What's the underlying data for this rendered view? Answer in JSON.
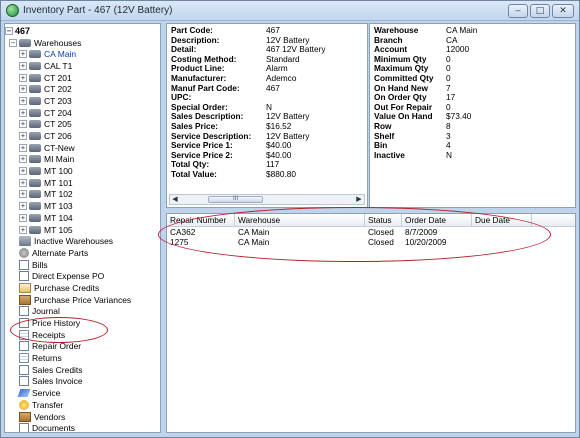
{
  "window": {
    "title": "Inventory Part - 467 (12V Battery)",
    "buttons": [
      "‒",
      "□",
      "✕"
    ]
  },
  "tree": {
    "root": "467",
    "warehouses_label": "Warehouses",
    "warehouses": [
      "CA Main",
      "CAL T1",
      "CT 201",
      "CT 202",
      "CT 203",
      "CT 204",
      "CT 205",
      "CT 206",
      "CT-New",
      "MI Main",
      "MT 100",
      "MT 101",
      "MT 102",
      "MT 103",
      "MT 104",
      "MT 105"
    ],
    "other_items": [
      "Inactive Warehouses",
      "Alternate Parts",
      "Bills",
      "Direct Expense PO",
      "Purchase Credits",
      "Purchase Price Variances",
      "Journal",
      "Price History",
      "Receipts",
      "Repair Order",
      "Returns",
      "Sales Credits",
      "Sales Invoice",
      "Service",
      "Transfer",
      "Vendors",
      "Documents"
    ]
  },
  "part_details": {
    "rows": [
      {
        "key": "Part Code:",
        "value": "467"
      },
      {
        "key": "Description:",
        "value": "12V Battery"
      },
      {
        "key": "Detail:",
        "value": "467 12V Battery"
      },
      {
        "key": "Costing Method:",
        "value": "Standard"
      },
      {
        "key": "Product Line:",
        "value": "Alarm"
      },
      {
        "key": "Manufacturer:",
        "value": "Ademco"
      },
      {
        "key": "Manuf Part Code:",
        "value": "467"
      },
      {
        "key": "UPC:",
        "value": ""
      },
      {
        "key": "Special Order:",
        "value": "N"
      },
      {
        "key": "Sales Description:",
        "value": "12V Battery"
      },
      {
        "key": "Sales Price:",
        "value": "$16.52"
      },
      {
        "key": "Service Description:",
        "value": "12V Battery"
      },
      {
        "key": "Service Price 1:",
        "value": "$40.00"
      },
      {
        "key": "Service Price 2:",
        "value": "$40.00"
      },
      {
        "key": "Total Qty:",
        "value": "117"
      },
      {
        "key": "Total Value:",
        "value": "$880.80"
      }
    ],
    "scroll_thumb": "III"
  },
  "warehouse_details": {
    "rows": [
      {
        "key": "Warehouse",
        "value": "CA Main"
      },
      {
        "key": "Branch",
        "value": "CA"
      },
      {
        "key": "Account",
        "value": "12000"
      },
      {
        "key": "Minimum Qty",
        "value": "0"
      },
      {
        "key": "Maximum Qty",
        "value": "0"
      },
      {
        "key": "Committed Qty",
        "value": "0"
      },
      {
        "key": "On Hand New",
        "value": "7"
      },
      {
        "key": "On Order Qty",
        "value": "17"
      },
      {
        "key": "Out For Repair",
        "value": "0"
      },
      {
        "key": "Value On Hand",
        "value": "$73.40"
      },
      {
        "key": "Row",
        "value": "8"
      },
      {
        "key": "Shelf",
        "value": "3"
      },
      {
        "key": "Bin",
        "value": "4"
      },
      {
        "key": "Inactive",
        "value": "N"
      }
    ]
  },
  "repair_table": {
    "columns": [
      "Repair Number",
      "Warehouse",
      "Status",
      "Order Date",
      "Due Date"
    ],
    "rows": [
      [
        "CA362",
        "CA Main",
        "Closed",
        "8/7/2009",
        ""
      ],
      [
        "1275",
        "CA Main",
        "Closed",
        "10/20/2009",
        ""
      ]
    ]
  }
}
